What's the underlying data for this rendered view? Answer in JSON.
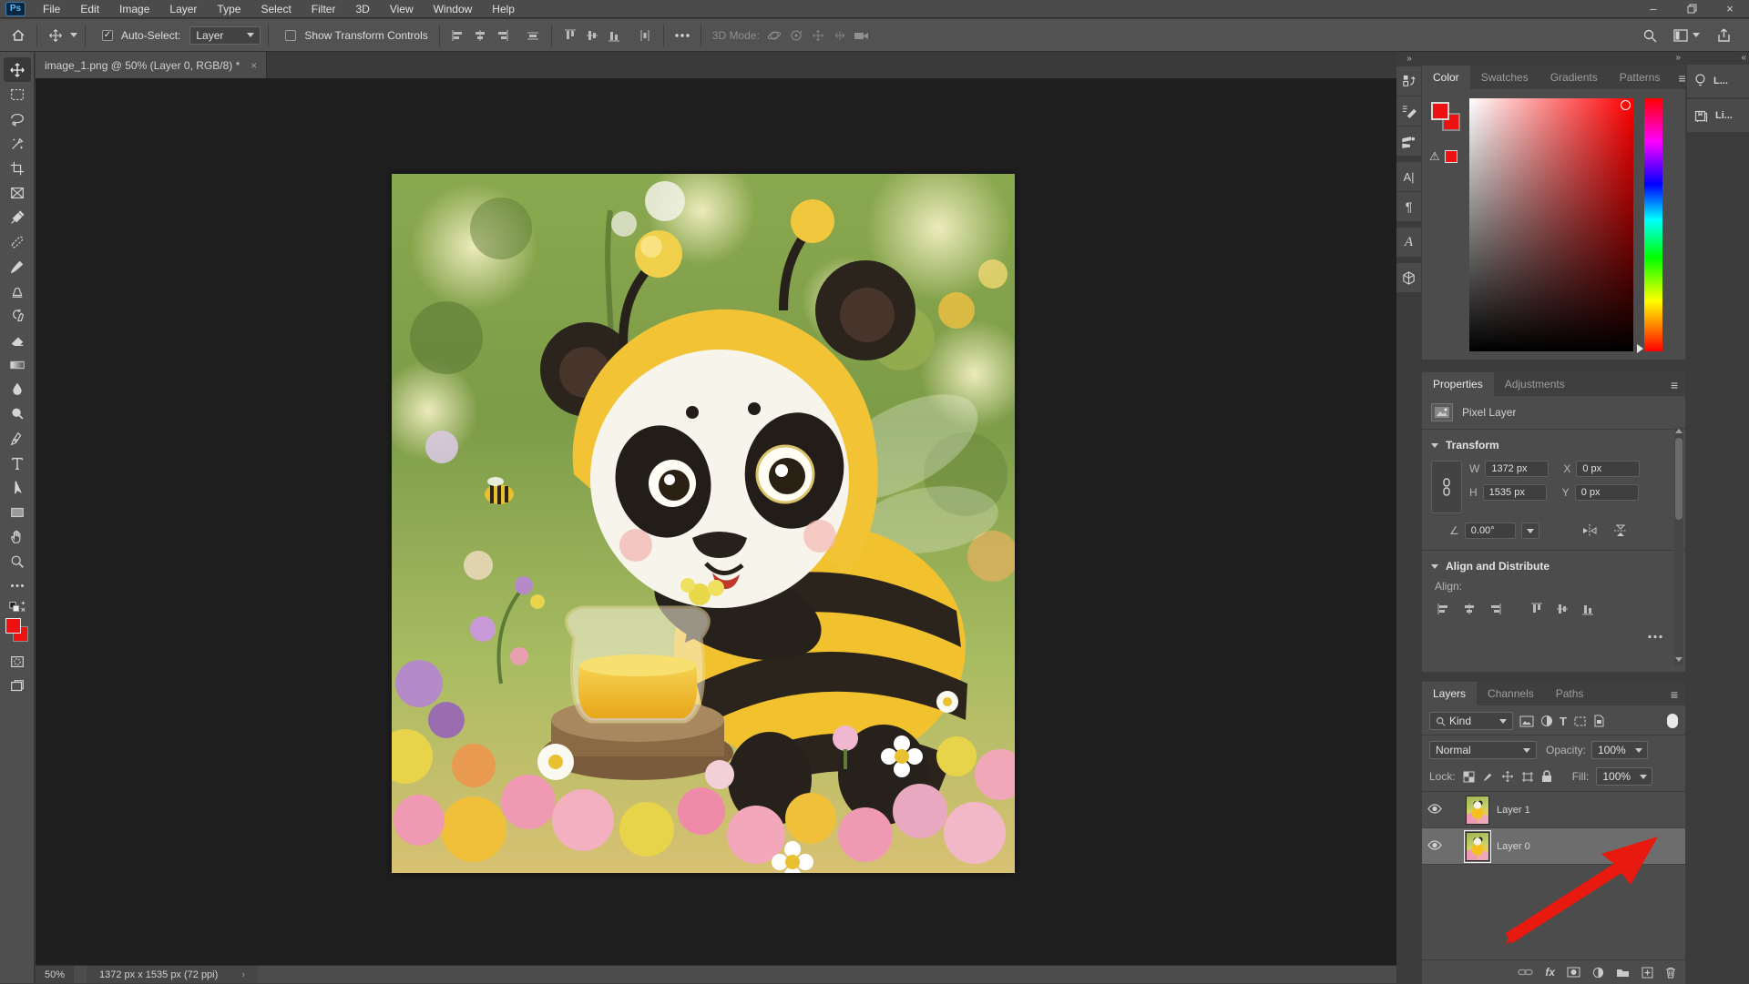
{
  "app": {
    "logo": "Ps",
    "menu": [
      "File",
      "Edit",
      "Image",
      "Layer",
      "Type",
      "Select",
      "Filter",
      "3D",
      "View",
      "Window",
      "Help"
    ]
  },
  "options": {
    "auto_select": "Auto-Select:",
    "auto_select_mode": "Layer",
    "show_transform": "Show Transform Controls",
    "mode_3d": "3D Mode:"
  },
  "doc": {
    "tab": "image_1.png @ 50% (Layer 0, RGB/8) *",
    "close": "×",
    "zoom": "50%",
    "dims": "1372 px x 1535 px (72 ppi)",
    "chevron": "›"
  },
  "color_panel": {
    "tabs": [
      "Color",
      "Swatches",
      "Gradients",
      "Patterns"
    ]
  },
  "properties": {
    "tabs": [
      "Properties",
      "Adjustments"
    ],
    "layer_kind": "Pixel Layer",
    "transform": "Transform",
    "w": "W",
    "w_val": "1372 px",
    "x": "X",
    "x_val": "0 px",
    "h": "H",
    "h_val": "1535 px",
    "y": "Y",
    "y_val": "0 px",
    "angle": "0.00°",
    "align_title": "Align and Distribute",
    "align": "Align:"
  },
  "layers_panel": {
    "tabs": [
      "Layers",
      "Channels",
      "Paths"
    ],
    "kind": "Kind",
    "blend": "Normal",
    "opacity_label": "Opacity:",
    "opacity": "100%",
    "lock": "Lock:",
    "fill_label": "Fill:",
    "fill": "100%",
    "fx": "fx",
    "rows": [
      {
        "name": "Layer 1"
      },
      {
        "name": "Layer 0"
      }
    ]
  },
  "rail": {
    "learn": "L...",
    "libraries": "Li..."
  },
  "colors": {
    "foreground": "#ee1111",
    "background": "#ee1111",
    "annotation_arrow": "#e8190e"
  }
}
